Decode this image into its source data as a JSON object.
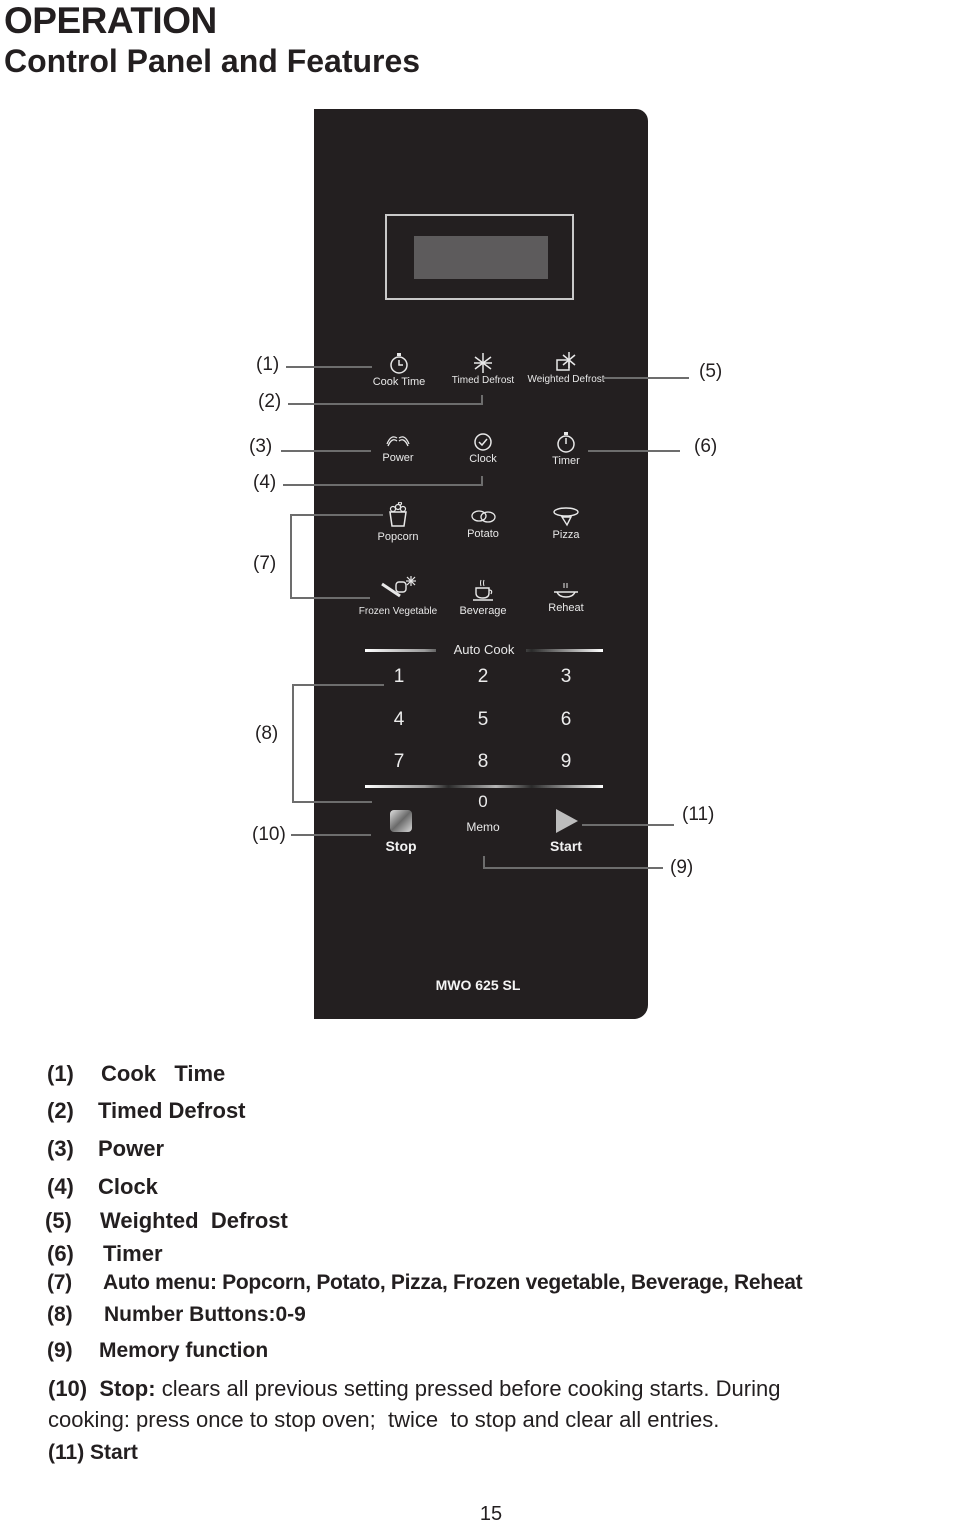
{
  "header": {
    "title": "OPERATION",
    "subtitle": "Control Panel and Features"
  },
  "panel": {
    "model": "MWO 625 SL",
    "row1": [
      {
        "label": "Cook Time",
        "icon": "stopwatch-icon"
      },
      {
        "label": "Timed Defrost",
        "icon": "snowflake-icon"
      },
      {
        "label": "Weighted Defrost",
        "icon": "scale-snowflake-icon"
      }
    ],
    "row2": [
      {
        "label": "Power",
        "icon": "power-waves-icon"
      },
      {
        "label": "Clock",
        "icon": "clock-icon"
      },
      {
        "label": "Timer",
        "icon": "timer-icon"
      }
    ],
    "row3": [
      {
        "label": "Popcorn",
        "icon": "popcorn-icon"
      },
      {
        "label": "Potato",
        "icon": "potato-icon"
      },
      {
        "label": "Pizza",
        "icon": "pizza-icon"
      }
    ],
    "row4": [
      {
        "label": "Frozen Vegetable",
        "icon": "vegetable-icon"
      },
      {
        "label": "Beverage",
        "icon": "cup-icon"
      },
      {
        "label": "Reheat",
        "icon": "plate-icon"
      }
    ],
    "auto_cook_label": "Auto Cook",
    "numbers": [
      "1",
      "2",
      "3",
      "4",
      "5",
      "6",
      "7",
      "8",
      "9"
    ],
    "zero": "0",
    "memo_label": "Memo",
    "stop_label": "Stop",
    "start_label": "Start"
  },
  "callouts": {
    "c1": "(1)",
    "c2": "(2)",
    "c3": "(3)",
    "c4": "(4)",
    "c5": "(5)",
    "c6": "(6)",
    "c7": "(7)",
    "c8": "(8)",
    "c9": "(9)",
    "c10": "(10)",
    "c11": "(11)"
  },
  "legend": [
    {
      "num": "(1)",
      "text": "Cook   Time"
    },
    {
      "num": "(2)",
      "text": "Timed Defrost"
    },
    {
      "num": "(3)",
      "text": "Power"
    },
    {
      "num": "(4)",
      "text": "Clock"
    },
    {
      "num": "(5)",
      "text": "Weighted  Defrost"
    },
    {
      "num": "(6)",
      "text": "Timer"
    },
    {
      "num": "(7)",
      "text": "Auto menu: Popcorn, Potato, Pizza, Frozen vegetable, Beverage, Reheat"
    },
    {
      "num": "(8)",
      "text": "Number Buttons:0-9"
    },
    {
      "num": "(9)",
      "text": "Memory function"
    }
  ],
  "stop_description": {
    "num": "(10)",
    "term": "Stop:",
    "line1": "clears all previous setting pressed before cooking starts. During",
    "line2": "cooking: press once to stop oven;  twice  to stop and clear all entries."
  },
  "start_item": {
    "num": "(11)",
    "text": "Start"
  },
  "page_number": "15"
}
